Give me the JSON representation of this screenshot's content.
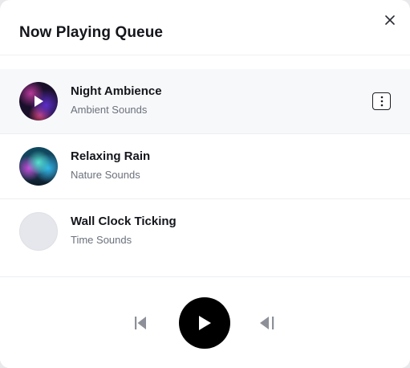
{
  "dialog": {
    "title": "Now Playing Queue",
    "close_icon": "close-icon"
  },
  "queue": [
    {
      "title": "Night Ambience",
      "subtitle": "Ambient Sounds",
      "active": true,
      "artwork": "night-ambience-artwork"
    },
    {
      "title": "Relaxing Rain",
      "subtitle": "Nature Sounds",
      "active": false,
      "artwork": "relaxing-rain-artwork"
    },
    {
      "title": "Wall Clock Ticking",
      "subtitle": "Time Sounds",
      "active": false,
      "artwork": "placeholder-artwork"
    }
  ],
  "player": {
    "prev_icon": "skip-previous-icon",
    "play_icon": "play-icon",
    "next_icon": "skip-next-icon"
  },
  "colors": {
    "accent": "#000000",
    "active_row": "#f7f8fa",
    "subtitle": "#6b707c"
  }
}
